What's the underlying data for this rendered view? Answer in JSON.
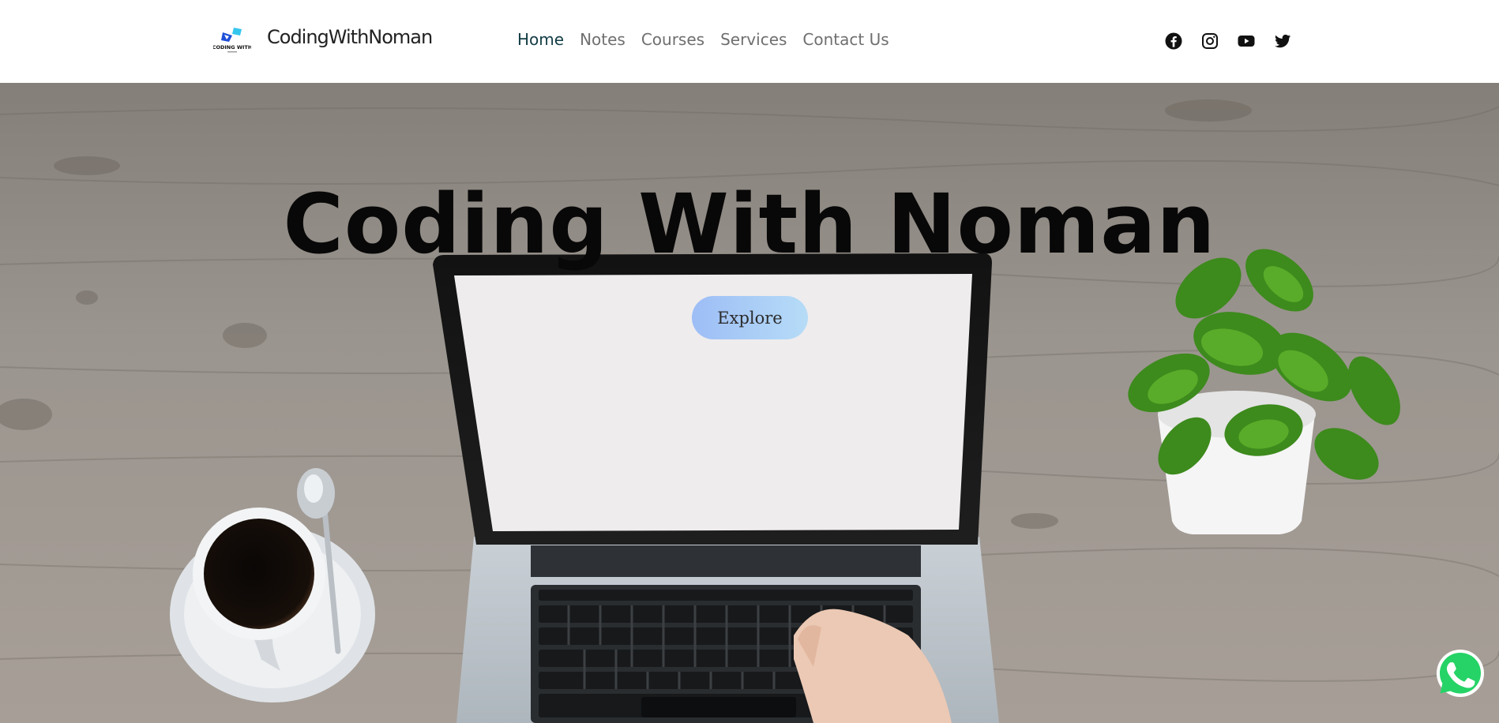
{
  "header": {
    "logo": {
      "icon": "coding-with-noman-logo",
      "text": "CODING WITH"
    },
    "brand": "CodingWithNoman",
    "nav": [
      {
        "label": "Home",
        "active": true
      },
      {
        "label": "Notes",
        "active": false
      },
      {
        "label": "Courses",
        "active": false
      },
      {
        "label": "Services",
        "active": false
      },
      {
        "label": "Contact Us",
        "active": false
      }
    ],
    "social": [
      "facebook-icon",
      "instagram-icon",
      "youtube-icon",
      "twitter-icon"
    ]
  },
  "hero": {
    "title": "Coding With Noman",
    "button_label": "Explore"
  },
  "floating": {
    "icon": "whatsapp-icon",
    "color": "#25d366"
  },
  "colors": {
    "nav_active": "#123c44",
    "nav_inactive": "#6f6f6f",
    "button_gradient_start": "#9dbdf6",
    "button_gradient_end": "#b6dcf7"
  }
}
